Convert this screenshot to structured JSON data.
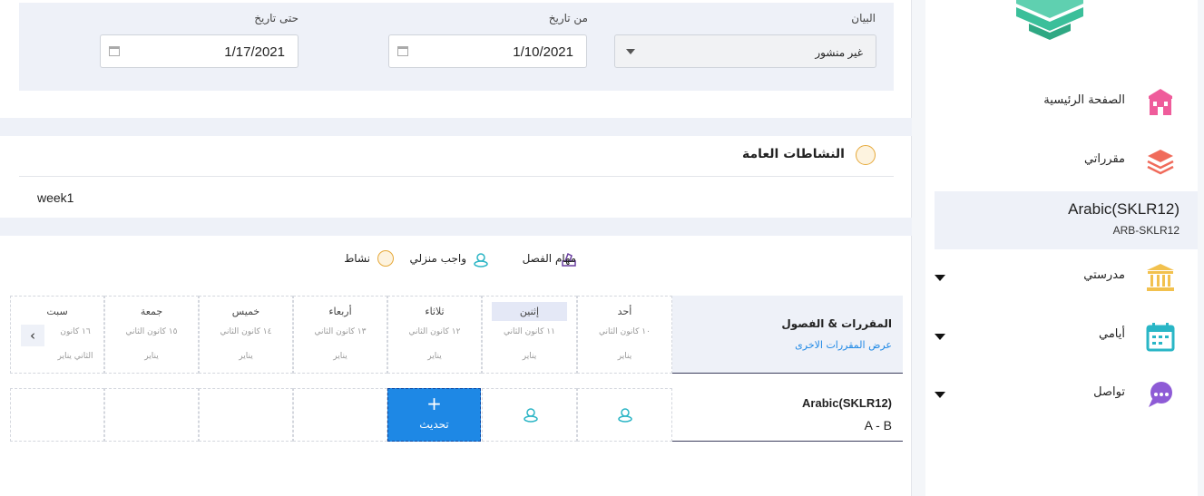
{
  "filter": {
    "statement_label": "البيان",
    "statement_value": "غير منشور",
    "from_label": "من تاريخ",
    "from_value": "1/10/2021",
    "to_label": "حتى تاريخ",
    "to_value": "1/17/2021"
  },
  "activities": {
    "title": "النشاطات العامة",
    "item": "week1"
  },
  "legend": {
    "class_tasks": "مهام الفصل",
    "homework": "واجب منزلي",
    "activity": "نشاط"
  },
  "schedule": {
    "courses_header": "المقررات & الفصول",
    "other_courses_link": "عرض المقررات الاخرى",
    "days": [
      {
        "name": "أحد",
        "date": "١٠ كانون الثاني",
        "month": "يناير"
      },
      {
        "name": "إثنين",
        "date": "١١ كانون الثاني",
        "month": "يناير"
      },
      {
        "name": "ثلاثاء",
        "date": "١٢ كانون الثاني",
        "month": "يناير"
      },
      {
        "name": "أربعاء",
        "date": "١٣ كانون الثاني",
        "month": "يناير"
      },
      {
        "name": "خميس",
        "date": "١٤ كانون الثاني",
        "month": "يناير"
      },
      {
        "name": "جمعة",
        "date": "١٥ كانون الثاني",
        "month": "يناير"
      },
      {
        "name": "سبت",
        "date": "١٦ كانون",
        "month": "الثاني يناير"
      }
    ],
    "course": {
      "name": "Arabic(SKLR12)",
      "section": "A - B"
    },
    "update_plus": "+",
    "update_label": "تحديث",
    "nav_arrow": "‹"
  },
  "sidebar": {
    "home": "الصفحة الرئيسية",
    "my_courses": "مقرراتي",
    "active_course_name": "Arabic(SKLR12)",
    "active_course_code": "ARB-SKLR12",
    "my_school": "مدرستي",
    "my_days": "أيامي",
    "communicate": "تواصل"
  },
  "colors": {
    "accent": "#1e88e5",
    "panel": "#eef1f8",
    "logo": "#3bbf9a",
    "home_icon": "#ef5c9b",
    "courses_icon": "#f06b5b",
    "school_icon": "#f2c14e",
    "days_icon": "#29b6c6",
    "chat_icon": "#8e5bd6"
  }
}
